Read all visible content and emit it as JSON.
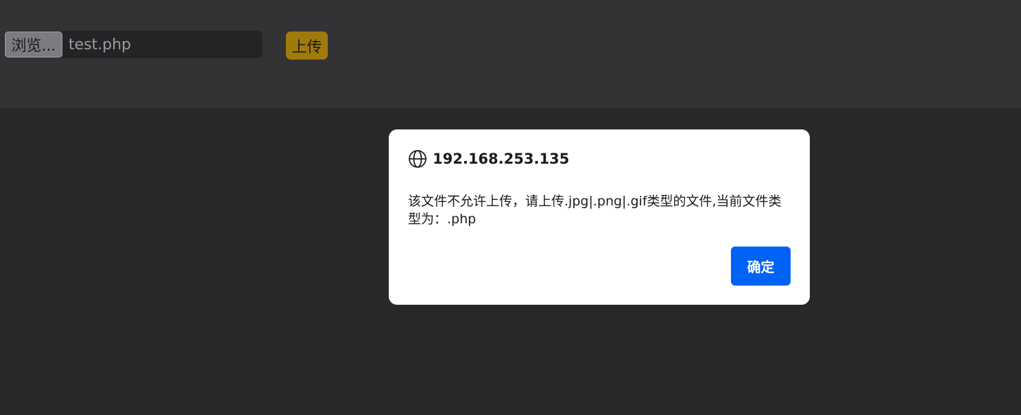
{
  "file_picker": {
    "browse_label": "浏览...",
    "file_name": "test.php"
  },
  "upload_button": {
    "label": "上传"
  },
  "dialog": {
    "origin": "192.168.253.135",
    "origin_icon": "globe-icon",
    "message": "该文件不允许上传，请上传.jpg|.png|.gif类型的文件,当前文件类型为：.php",
    "ok_label": "确定"
  },
  "colors": {
    "page_background": "#28282b",
    "top_bar_background": "#333336",
    "upload_button": "#a17a0c",
    "dialog_background": "#ffffff",
    "ok_button": "#0063f5"
  }
}
